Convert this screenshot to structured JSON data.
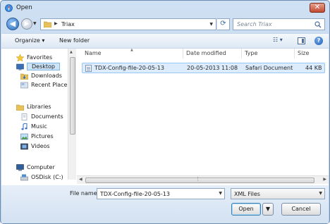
{
  "window": {
    "title": "Open",
    "close_glyph": "✕"
  },
  "address": {
    "path": [
      "Triax"
    ],
    "search_placeholder": "Search Triax"
  },
  "toolbar": {
    "organize_label": "Organize ▾",
    "new_folder_label": "New folder",
    "views_glyph": "☷ ▾",
    "help_glyph": "?"
  },
  "nav_pane": {
    "favorites_header": "Favorites",
    "favorites": [
      {
        "label": "Desktop",
        "icon": "desktop-icon",
        "selected": true
      },
      {
        "label": "Downloads",
        "icon": "downloads-icon"
      },
      {
        "label": "Recent Places",
        "icon": "recent-places-icon"
      }
    ],
    "libraries_header": "Libraries",
    "libraries": [
      {
        "label": "Documents",
        "icon": "documents-icon"
      },
      {
        "label": "Music",
        "icon": "music-icon"
      },
      {
        "label": "Pictures",
        "icon": "pictures-icon"
      },
      {
        "label": "Videos",
        "icon": "videos-icon"
      }
    ],
    "computer_header": "Computer",
    "drives": [
      {
        "label": "OSDisk (C:)",
        "icon": "drive-icon"
      }
    ]
  },
  "file_list": {
    "columns": [
      "Name",
      "Date modified",
      "Type",
      "Size"
    ],
    "rows": [
      {
        "name": "TDX-Config-file-20-05-13",
        "date_modified": "20-05-2013 11:08",
        "type": "Safari Document",
        "size": "44 KB",
        "selected": true
      }
    ]
  },
  "bottom": {
    "file_name_label": "File name:",
    "file_name_value": "TDX-Config-file-20-05-13",
    "file_type_value": "XML Files",
    "open_label": "Open",
    "cancel_label": "Cancel"
  },
  "colors": {
    "selection_bg": "#dcecfc",
    "selection_border": "#98c7f3",
    "chrome": "#cfe0f3"
  }
}
